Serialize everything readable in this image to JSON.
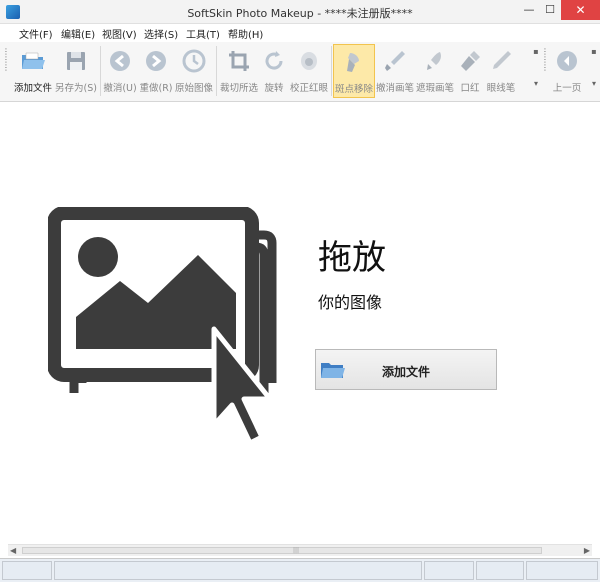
{
  "window": {
    "title": "SoftSkin Photo Makeup - ****未注册版****",
    "min_glyph": "—",
    "max_glyph": "☐",
    "close_glyph": "✕"
  },
  "menu": {
    "items": [
      "文件(F)",
      "编辑(E)",
      "视图(V)",
      "选择(S)",
      "工具(T)",
      "帮助(H)"
    ]
  },
  "toolbar": {
    "buttons": [
      {
        "label": "添加文件",
        "icon": "open-folder-icon",
        "enabled": true
      },
      {
        "label": "另存为(S)",
        "icon": "save-icon",
        "enabled": false
      },
      {
        "label": "撤消(U)",
        "icon": "undo-icon",
        "enabled": false
      },
      {
        "label": "重做(R)",
        "icon": "redo-icon",
        "enabled": false
      },
      {
        "label": "原始图像",
        "icon": "clock-icon",
        "enabled": false
      },
      {
        "label": "裁切所选",
        "icon": "crop-icon",
        "enabled": false
      },
      {
        "label": "旋转",
        "icon": "rotate-icon",
        "enabled": false
      },
      {
        "label": "校正红眼",
        "icon": "eye-icon",
        "enabled": false
      },
      {
        "label": "斑点移除",
        "icon": "spot-brush-icon",
        "enabled": false,
        "active": true
      },
      {
        "label": "撤消画笔",
        "icon": "undo-brush-icon",
        "enabled": false
      },
      {
        "label": "遮瑕画笔",
        "icon": "concealer-brush-icon",
        "enabled": false
      },
      {
        "label": "口红",
        "icon": "lipstick-icon",
        "enabled": false
      },
      {
        "label": "眼线笔",
        "icon": "eyeliner-icon",
        "enabled": false
      },
      {
        "label": "上一页",
        "icon": "previous-page-icon",
        "enabled": false
      }
    ]
  },
  "drop_zone": {
    "title": "拖放",
    "subtitle": "你的图像",
    "add_button_label": "添加文件",
    "add_button_icon": "open-folder-icon"
  },
  "colors": {
    "close_button": "#e04343",
    "active_tool_bg": "#fde9a8",
    "icon_dark": "#3c3c3c",
    "toolbar_blue": "#4a90d9"
  }
}
